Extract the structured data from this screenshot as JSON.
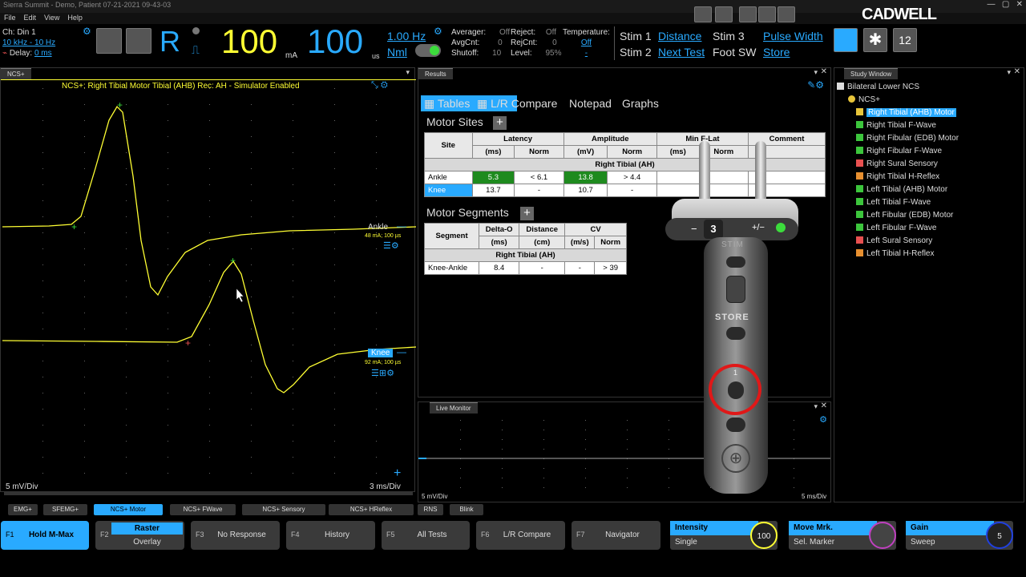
{
  "window_title": "Sierra Summit - Demo, Patient 07-21-2021 09-43-03",
  "menu": [
    "File",
    "Edit",
    "View",
    "Help"
  ],
  "channel": {
    "name": "Ch: Din 1",
    "filters": "10 kHz - 10 Hz",
    "delay_label": "Delay:",
    "delay": "0 ms"
  },
  "stim": {
    "side": "R",
    "intensity": "100",
    "intensity_unit": "mA",
    "duration": "100",
    "duration_unit": "us",
    "rate": "1.00 Hz",
    "mode": "Nml"
  },
  "averager": {
    "averager_label": "Averager:",
    "averager": "Off",
    "avgcnt_label": "AvgCnt:",
    "avgcnt": "0",
    "shutoff_label": "Shutoff:",
    "shutoff": "10",
    "reject_label": "Reject:",
    "reject": "Off",
    "rejcnt_label": "RejCnt:",
    "rejcnt": "0",
    "level_label": "Level:",
    "level": "95%",
    "temp_label": "Temperature:",
    "temp": "Off",
    "temp2": "-"
  },
  "stim_buttons": {
    "stim1": "Stim 1",
    "distance": "Distance",
    "stim3": "Stim 3",
    "pulse_width": "Pulse Width",
    "stim2": "Stim 2",
    "next_test": "Next Test",
    "foot_sw": "Foot SW",
    "store": "Store"
  },
  "brand": "CADWELL",
  "ncs_panel": {
    "tab": "NCS+",
    "header": "NCS+: Right Tibial Motor   Tibial (AHB)   Rec: AH - Simulator Enabled",
    "trace1_label": "Ankle",
    "trace1_info": "48 mA; 100 µs",
    "trace2_label": "Knee",
    "trace2_info": "92 mA; 100 µs",
    "sens": "5 mV/Div",
    "sweep": "3 ms/Div"
  },
  "results": {
    "tab": "Results",
    "subtabs": [
      "Tables",
      "L/R Compare",
      "Notepad",
      "Graphs"
    ],
    "motor_sites_title": "Motor Sites",
    "sites_headers": {
      "site": "Site",
      "latency": "Latency",
      "amplitude": "Amplitude",
      "minflat": "Min F-Lat",
      "comment": "Comment",
      "ms": "(ms)",
      "norm": "Norm",
      "mv": "(mV)"
    },
    "sites_section": "Right Tibial (AH)",
    "sites_rows": [
      {
        "site": "Ankle",
        "lat": "5.3",
        "lat_norm": "< 6.1",
        "amp": "13.8",
        "amp_norm": "> 4.4"
      },
      {
        "site": "Knee",
        "lat": "13.7",
        "lat_norm": "-",
        "amp": "10.7",
        "amp_norm": "-"
      }
    ],
    "segments_title": "Motor Segments",
    "seg_headers": {
      "segment": "Segment",
      "delta": "Delta-O",
      "distance": "Distance",
      "cv": "CV",
      "ms": "(ms)",
      "cm": "(cm)",
      "ms2": "(m/s)",
      "norm": "Norm"
    },
    "seg_section": "Right Tibial (AH)",
    "seg_rows": [
      {
        "segment": "Knee-Ankle",
        "delta": "8.4",
        "dist": "-",
        "cv": "-",
        "norm": "> 39"
      }
    ]
  },
  "probe": {
    "minus": "−",
    "count": "3",
    "plusminus": "+/−",
    "stim": "STIM",
    "store": "STORE",
    "one": "1"
  },
  "live_monitor": {
    "tab": "Live Monitor",
    "sens": "5 mV/Div",
    "sweep": "5 ms/Div"
  },
  "study": {
    "tab": "Study Window",
    "root": "Bilateral Lower NCS",
    "group": "NCS+",
    "items": [
      "Right Tibial (AHB) Motor",
      "Right Tibial F-Wave",
      "Right Fibular (EDB) Motor",
      "Right Fibular F-Wave",
      "Right Sural Sensory",
      "Right Tibial H-Reflex",
      "Left Tibial (AHB) Motor",
      "Left Tibial F-Wave",
      "Left Fibular (EDB) Motor",
      "Left Fibular F-Wave",
      "Left Sural Sensory",
      "Left Tibial H-Reflex"
    ],
    "icon_colors": [
      "#e8c53a",
      "#3cc53c",
      "#3cc53c",
      "#3cc53c",
      "#e85050",
      "#e89030",
      "#3cc53c",
      "#3cc53c",
      "#3cc53c",
      "#3cc53c",
      "#e85050",
      "#e89030"
    ]
  },
  "test_tabs": [
    "EMG+",
    "SFEMG+",
    "NCS+ Motor",
    "NCS+ FWave",
    "NCS+ Sensory",
    "NCS+ HReflex",
    "RNS",
    "Blink"
  ],
  "fkeys": [
    {
      "key": "F1",
      "label": "Hold M-Max"
    },
    {
      "key": "F2",
      "label": "Raster",
      "label2": "Overlay"
    },
    {
      "key": "F3",
      "label": "No Response"
    },
    {
      "key": "F4",
      "label": "History"
    },
    {
      "key": "F5",
      "label": "All Tests"
    },
    {
      "key": "F6",
      "label": "L/R Compare"
    },
    {
      "key": "F7",
      "label": "Navigator"
    }
  ],
  "knobs": [
    {
      "title": "Intensity",
      "sub": "Single",
      "value": "100"
    },
    {
      "title": "Move Mrk.",
      "sub": "Sel. Marker",
      "value": ""
    },
    {
      "title": "Gain",
      "sub": "Sweep",
      "value": "5"
    }
  ]
}
